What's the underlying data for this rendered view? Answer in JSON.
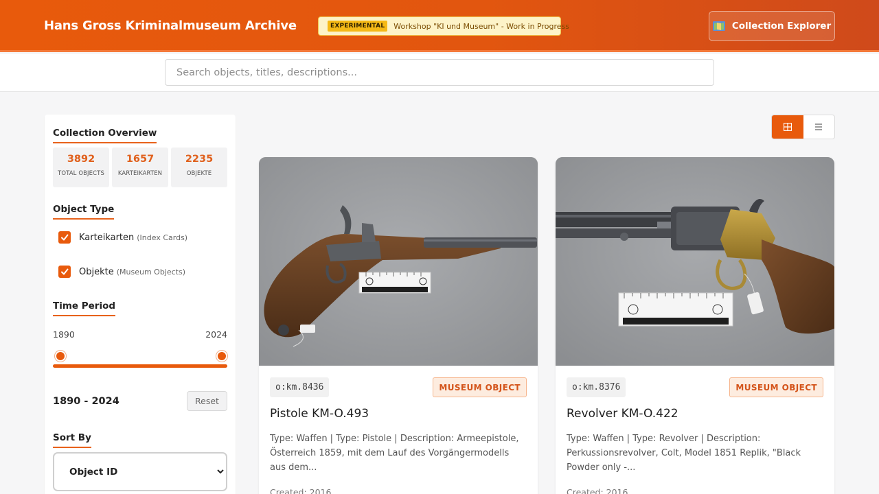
{
  "header": {
    "title": "Hans Gross Kriminalmuseum Archive",
    "banner_badge": "EXPERIMENTAL",
    "banner_text": "Workshop \"KI und Museum\" - Work in Progress",
    "explorer_button": "Collection Explorer",
    "explorer_icon": "map-icon",
    "accent_color": "#e85a0c"
  },
  "search": {
    "placeholder": "Search objects, titles, descriptions...",
    "value": ""
  },
  "sidebar": {
    "overview_title": "Collection Overview",
    "stats": [
      {
        "value": "3892",
        "label": "TOTAL OBJECTS"
      },
      {
        "value": "1657",
        "label": "KARTEIKARTEN"
      },
      {
        "value": "2235",
        "label": "OBJEKTE"
      }
    ],
    "object_type_title": "Object Type",
    "object_types": [
      {
        "label": "Karteikarten",
        "sub": "(Index Cards)",
        "checked": true
      },
      {
        "label": "Objekte",
        "sub": "(Museum Objects)",
        "checked": true
      }
    ],
    "time_title": "Time Period",
    "time_min": "1890",
    "time_max": "2024",
    "time_range_value": "1890 - 2024",
    "reset_label": "Reset",
    "sort_title": "Sort By",
    "sort_selected": "Object ID"
  },
  "view_toggle": {
    "grid_icon": "grid-icon",
    "list_icon": "list-icon",
    "active": "grid"
  },
  "cards": [
    {
      "id": "o:km.8436",
      "type_badge": "MUSEUM OBJECT",
      "title": "Pistole KM-O.493",
      "description": "Type: Waffen | Type: Pistole | Description: Armeepistole, Österreich 1859, mit dem Lauf des Vorgängermodells aus dem...",
      "created": "Created: 2016",
      "image": "pistol-photo"
    },
    {
      "id": "o:km.8376",
      "type_badge": "MUSEUM OBJECT",
      "title": "Revolver KM-O.422",
      "description": "Type: Waffen | Type: Revolver | Description: Perkussionsrevolver, Colt, Model 1851 Replik, \"Black Powder only -...",
      "created": "Created: 2016",
      "image": "revolver-photo"
    }
  ]
}
